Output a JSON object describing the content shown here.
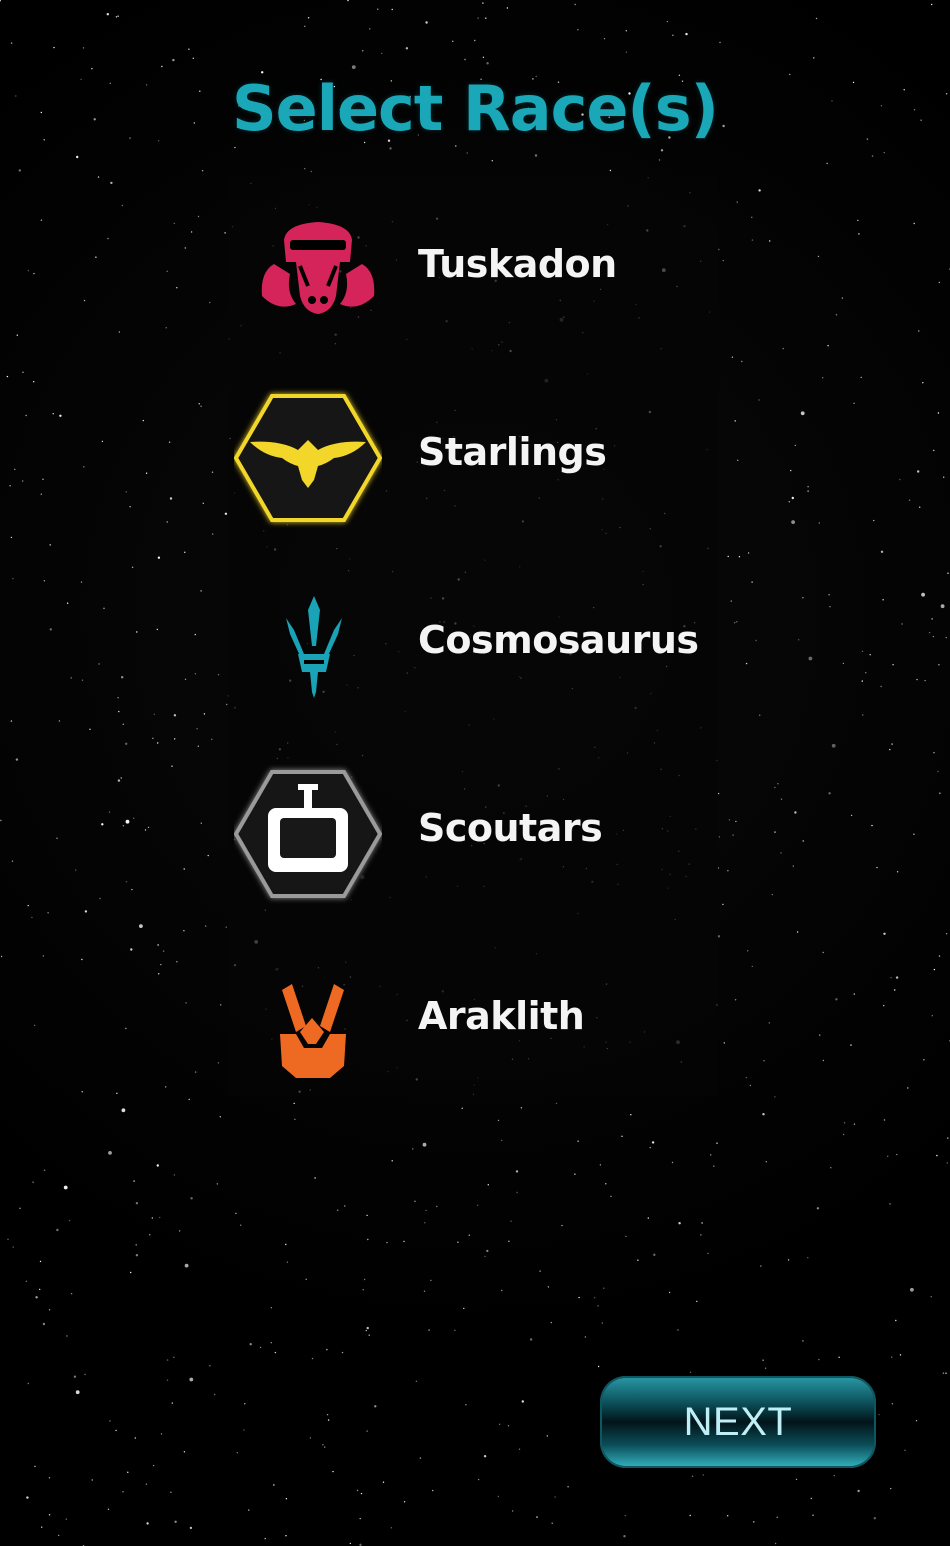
{
  "screen": {
    "title": "Select Race(s)"
  },
  "races": [
    {
      "label": "Tuskadon",
      "icon": "tuskadon-emblem-icon",
      "color": "#d4245a",
      "selected": false
    },
    {
      "label": "Starlings",
      "icon": "starlings-emblem-icon",
      "color": "#f2d72a",
      "selected": true
    },
    {
      "label": "Cosmosaurus",
      "icon": "cosmosaurus-emblem-icon",
      "color": "#1aa2b6",
      "selected": false
    },
    {
      "label": "Scoutars",
      "icon": "scoutars-emblem-icon",
      "color": "#ffffff",
      "selected": true
    },
    {
      "label": "Araklith",
      "icon": "araklith-emblem-icon",
      "color": "#ee6a22",
      "selected": false
    }
  ],
  "next_button": {
    "label": "NEXT"
  },
  "colors": {
    "title": "#1aa8b8",
    "label": "#f4f4f4",
    "background": "#000000"
  }
}
